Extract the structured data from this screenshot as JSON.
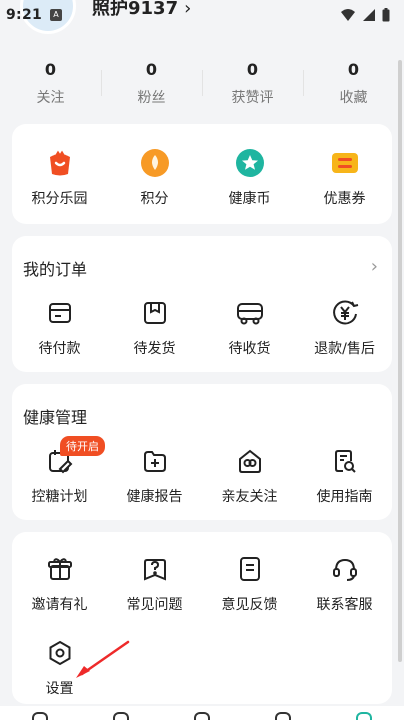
{
  "status": {
    "time": "9:21",
    "badge": "A"
  },
  "profile": {
    "name": "照护9137",
    "chevron": "›"
  },
  "stats": [
    {
      "num": "0",
      "label": "关注"
    },
    {
      "num": "0",
      "label": "粉丝"
    },
    {
      "num": "0",
      "label": "获赞评"
    },
    {
      "num": "0",
      "label": "收藏"
    }
  ],
  "points": [
    {
      "label": "积分乐园",
      "icon": "gift-bag-icon"
    },
    {
      "label": "积分",
      "icon": "points-coin-icon"
    },
    {
      "label": "健康币",
      "icon": "health-coin-icon"
    },
    {
      "label": "优惠券",
      "icon": "coupon-icon"
    }
  ],
  "orders": {
    "title": "我的订单",
    "more": "›",
    "items": [
      {
        "label": "待付款",
        "icon": "wallet-icon"
      },
      {
        "label": "待发货",
        "icon": "package-icon"
      },
      {
        "label": "待收货",
        "icon": "delivery-truck-icon"
      },
      {
        "label": "退款/售后",
        "icon": "refund-icon"
      }
    ]
  },
  "health": {
    "title": "健康管理",
    "badge": "待开启",
    "items": [
      {
        "label": "控糖计划",
        "icon": "sugar-plan-icon"
      },
      {
        "label": "健康报告",
        "icon": "report-folder-icon"
      },
      {
        "label": "亲友关注",
        "icon": "family-care-icon"
      },
      {
        "label": "使用指南",
        "icon": "guide-icon"
      }
    ]
  },
  "services": {
    "items": [
      {
        "label": "邀请有礼",
        "icon": "invite-gift-icon"
      },
      {
        "label": "常见问题",
        "icon": "faq-icon"
      },
      {
        "label": "意见反馈",
        "icon": "feedback-icon"
      },
      {
        "label": "联系客服",
        "icon": "headset-icon"
      }
    ],
    "settings": {
      "label": "设置",
      "icon": "settings-hexagon-icon"
    }
  },
  "colors": {
    "accent_red": "#f04e23",
    "accent_orange": "#f79a26",
    "accent_teal": "#1fb5a0",
    "accent_yellow": "#f7b51a"
  }
}
